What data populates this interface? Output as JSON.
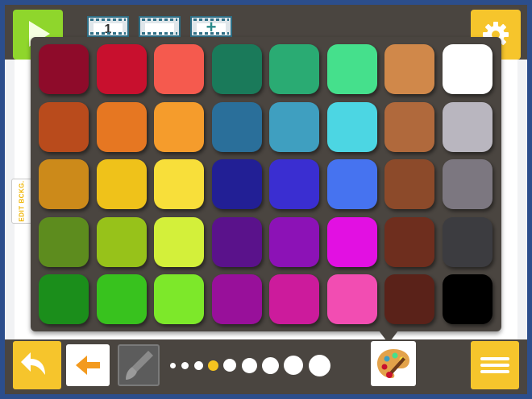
{
  "app": {
    "frames": [
      {
        "label": "1"
      },
      {
        "label": ""
      },
      {
        "label": "+"
      }
    ],
    "edit_background_label": "EDIT BCKG."
  },
  "palette": {
    "colors": [
      "#8e0b2a",
      "#c8102e",
      "#f55a4e",
      "#1a7a5a",
      "#2aab73",
      "#45e08c",
      "#d0884a",
      "#ffffff",
      "#b94b1c",
      "#e67722",
      "#f59c2c",
      "#2a6f9a",
      "#3f9fc0",
      "#4cd6e3",
      "#b0693c",
      "#b9b6bf",
      "#cc8a1a",
      "#efc21a",
      "#f8df3a",
      "#221f95",
      "#3a2ed1",
      "#4673f0",
      "#8c4a2a",
      "#7c7780",
      "#5d8c1e",
      "#97c21a",
      "#d3f03a",
      "#5a128b",
      "#8c12b6",
      "#e210e2",
      "#6e2e1e",
      "#3c3c40",
      "#1b8e1b",
      "#38c21e",
      "#7de82a",
      "#98109a",
      "#cc1b9c",
      "#f24db2",
      "#5a2219",
      "#000000"
    ]
  },
  "toolbar": {
    "brush_sizes_count": 9,
    "active_brush_size_index": 3
  },
  "colors": {
    "accent_yellow": "#f6c52c",
    "accent_green": "#8fd62c",
    "panel_dark": "#4a4540",
    "window_border": "#2c4e8c"
  },
  "icons": {
    "play": "play-icon",
    "settings": "gear-icon",
    "undo": "undo-icon",
    "back": "arrow-left-icon",
    "brush": "brush-icon",
    "palette": "palette-icon",
    "menu": "hamburger-menu-icon"
  }
}
